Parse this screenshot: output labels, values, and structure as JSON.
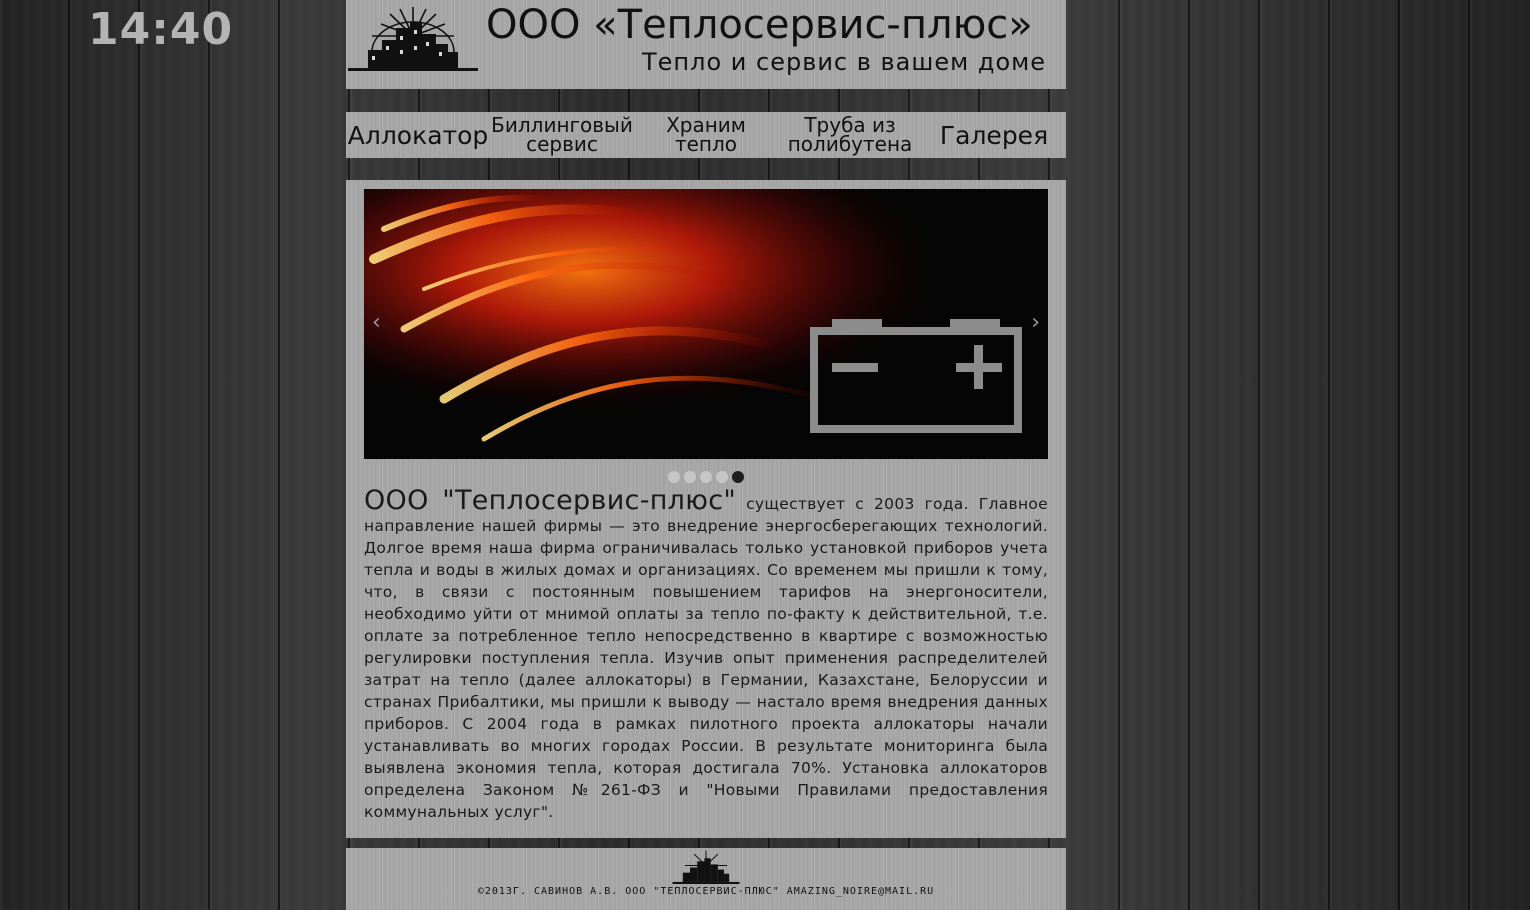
{
  "clock": "14:40",
  "header": {
    "title": "ООО «Теплосервис-плюс»",
    "subtitle": "Тепло и сервис в вашем доме"
  },
  "nav": {
    "items": [
      {
        "line1": "Аллокатор",
        "line2": ""
      },
      {
        "line1": "Биллинговый",
        "line2": "сервис"
      },
      {
        "line1": "Храним",
        "line2": "тепло"
      },
      {
        "line1": "Труба из",
        "line2": "полибутена"
      },
      {
        "line1": "Галерея",
        "line2": ""
      }
    ]
  },
  "slider": {
    "prev_icon": "chevron-left-icon",
    "next_icon": "chevron-right-icon",
    "dots": 5,
    "active_dot": 5
  },
  "article": {
    "lead": "ООО \"Теплосервис-плюс\"",
    "body": " существует с 2003 года. Главное направление нашей фирмы — это внедрение энергосберегающих технологий. Долгое время наша фирма ограничивалась только установкой приборов учета тепла и воды в жилых домах и организациях. Со временем мы пришли к тому, что, в связи с постоянным повышением тарифов на энергоносители, необходимо уйти от мнимой оплаты за тепло по-факту к действительной, т.е. оплате за потребленное тепло непосредственно в квартире с возможностью регулировки поступления тепла. Изучив опыт применения распределителей затрат на тепло (далее аллокаторы) в Германии, Казахстане, Белоруссии и странах Прибалтики, мы пришли к выводу — настало время внедрения данных приборов. С 2004 года в рамках пилотного проекта аллокаторы начали устанавливать во многих городах России. В результате мониторинга была выявлена экономия тепла, которая достигала 70%. Установка аллокаторов определена Законом №261-ФЗ и \"Новыми Правилами предоставления коммунальных услуг\"."
  },
  "footer": {
    "text": "©2013г. Савинов А.В. ООО \"Теплосервис-плюс\" amazing_noire@mail.ru"
  }
}
